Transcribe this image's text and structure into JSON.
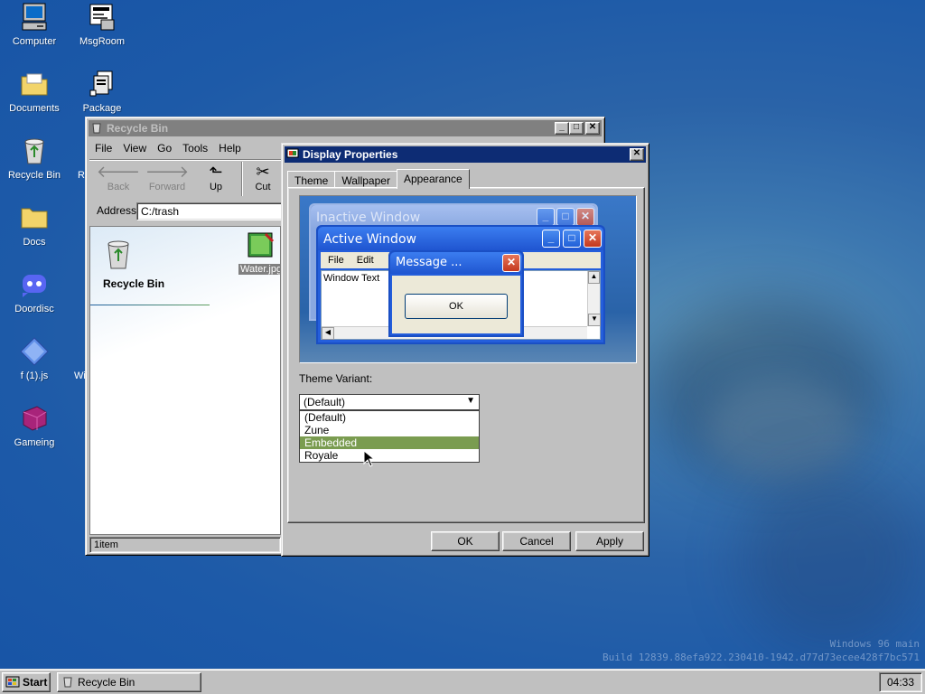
{
  "desktop": {
    "icons": [
      {
        "label": "Computer",
        "icon": "computer-icon"
      },
      {
        "label": "MsgRoom",
        "icon": "msgroom-icon"
      },
      {
        "label": "Documents",
        "icon": "folder-icon"
      },
      {
        "label": "Package",
        "icon": "package-icon"
      },
      {
        "label": "Recycle Bin",
        "icon": "recycle-bin-icon"
      },
      {
        "label": "Docs",
        "icon": "folder-icon"
      },
      {
        "label": "Doordisc",
        "icon": "doordisc-icon"
      },
      {
        "label": "f (1).js",
        "icon": "script-icon"
      },
      {
        "label": "Gameing",
        "icon": "game-icon"
      }
    ],
    "partial_labels": [
      "R",
      "Wi"
    ],
    "watermark_line1": "Windows 96 main",
    "watermark_line2": "Build 12839.88efa922.230410-1942.d77d73ecee428f7bc571"
  },
  "recycle_window": {
    "title": "Recycle Bin",
    "menu": [
      "File",
      "View",
      "Go",
      "Tools",
      "Help"
    ],
    "toolbar": [
      {
        "label": "Back",
        "icon": "back-arrow-icon",
        "enabled": false
      },
      {
        "label": "Forward",
        "icon": "forward-arrow-icon",
        "enabled": false
      },
      {
        "label": "Up",
        "icon": "folder-up-icon",
        "enabled": true
      },
      {
        "label": "Cut",
        "icon": "scissors-icon",
        "enabled": true
      }
    ],
    "address_label": "Address",
    "address_value": "C:/trash",
    "heading": "Recycle Bin",
    "file": "Water.jpg",
    "status": "1item"
  },
  "display_window": {
    "title": "Display Properties",
    "tabs": [
      "Theme",
      "Wallpaper",
      "Appearance"
    ],
    "selected_tab": "Appearance",
    "preview": {
      "inactive_title": "Inactive Window",
      "active_title": "Active Window",
      "menu": [
        "File",
        "Edit"
      ],
      "window_text": "Window Text",
      "message_title": "Message ...",
      "ok": "OK"
    },
    "theme_variant_label": "Theme Variant:",
    "selected_variant": "(Default)",
    "options": [
      "(Default)",
      "Zune",
      "Embedded",
      "Royale"
    ],
    "highlighted_option": "Embedded",
    "buttons": {
      "ok": "OK",
      "cancel": "Cancel",
      "apply": "Apply"
    }
  },
  "taskbar": {
    "start": "Start",
    "task": "Recycle Bin",
    "clock": "04:33"
  },
  "colors": {
    "desktop": "#1d5aa8",
    "title_inactive": "#808080",
    "title_active": "#0d2c74",
    "dropdown_highlight": "#7a9c50",
    "xp_blue": "#245edb"
  }
}
